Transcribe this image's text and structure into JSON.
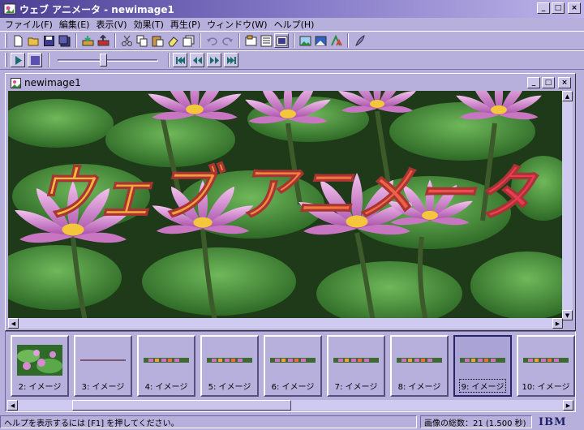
{
  "app": {
    "title": "ウェブ アニメータ - newimage1"
  },
  "window_controls": {
    "minimize": "_",
    "maximize": "□",
    "close": "×"
  },
  "menu": [
    {
      "label": "ファイル(F)"
    },
    {
      "label": "編集(E)"
    },
    {
      "label": "表示(V)"
    },
    {
      "label": "効果(T)"
    },
    {
      "label": "再生(P)"
    },
    {
      "label": "ウィンドウ(W)"
    },
    {
      "label": "ヘルプ(H)"
    }
  ],
  "document": {
    "title": "newimage1",
    "banner_text": "ウェブ アニメータ",
    "banner_colors": [
      "#f2c23a",
      "#f39a39",
      "#f06a40",
      "#e8335a"
    ]
  },
  "player": {
    "position": 0.45
  },
  "frames": [
    {
      "label": "2: イメージ",
      "kind": "full"
    },
    {
      "label": "3: イメージ",
      "kind": "thin"
    },
    {
      "label": "4: イメージ",
      "kind": "strip"
    },
    {
      "label": "5: イメージ",
      "kind": "strip"
    },
    {
      "label": "6: イメージ",
      "kind": "strip"
    },
    {
      "label": "7: イメージ",
      "kind": "strip"
    },
    {
      "label": "8: イメージ",
      "kind": "strip"
    },
    {
      "label": "9: イメージ",
      "kind": "strip",
      "selected": true
    },
    {
      "label": "10: イメージ",
      "kind": "strip"
    }
  ],
  "status": {
    "help": "ヘルプを表示するには [F1] を押してください。",
    "total": "画像の総数：21 (1.500 秒)",
    "logo": "IBM"
  }
}
